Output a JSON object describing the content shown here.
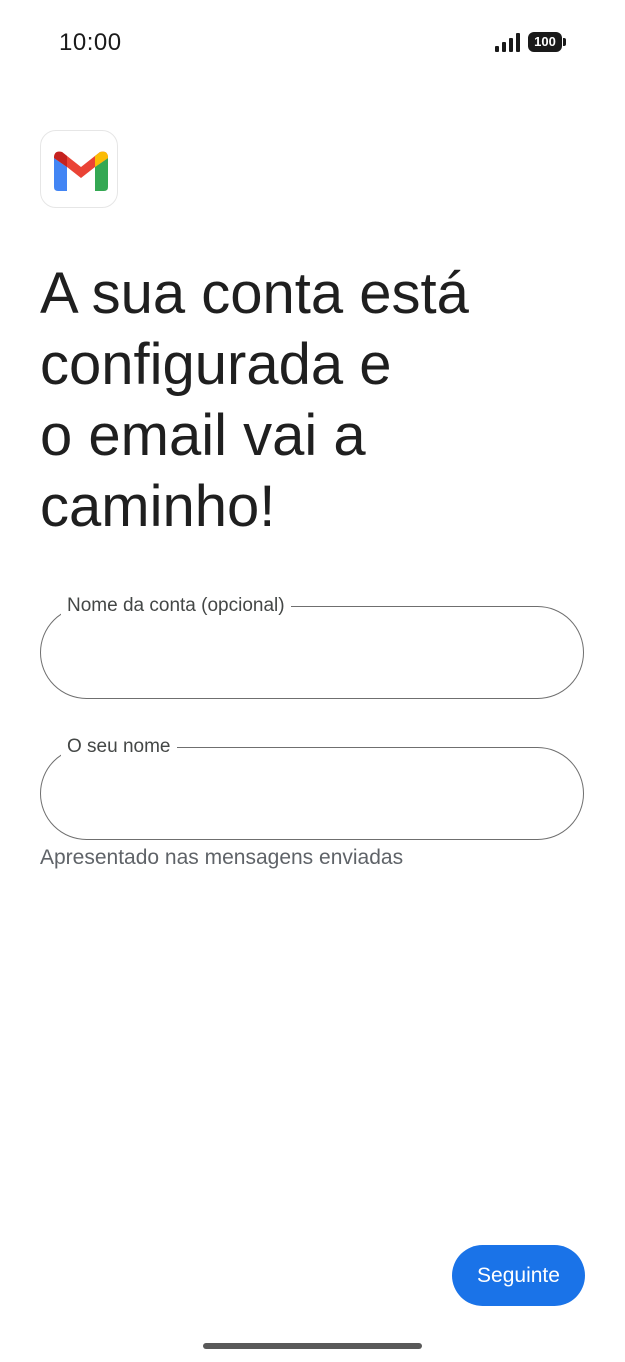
{
  "status_bar": {
    "time": "10:00",
    "battery_level": "100",
    "icons": [
      "signal-icon",
      "battery-icon"
    ]
  },
  "app": {
    "logo_icon": "gmail-logo-icon",
    "brand_colors": {
      "red": "#EA4335",
      "blue": "#4285F4",
      "green": "#34A853",
      "yellow": "#FBBC04",
      "dark_red": "#C5221F"
    }
  },
  "headline": {
    "line1": "A sua conta está",
    "line2": "configurada e",
    "line3": "o email vai a",
    "line4": "caminho!"
  },
  "form": {
    "account_name": {
      "label": "Nome da conta (opcional)",
      "value": ""
    },
    "your_name": {
      "label": "O seu nome",
      "value": "",
      "helper": "Apresentado nas mensagens enviadas"
    }
  },
  "actions": {
    "next_label": "Seguinte",
    "accent_color": "#1A73E8"
  }
}
